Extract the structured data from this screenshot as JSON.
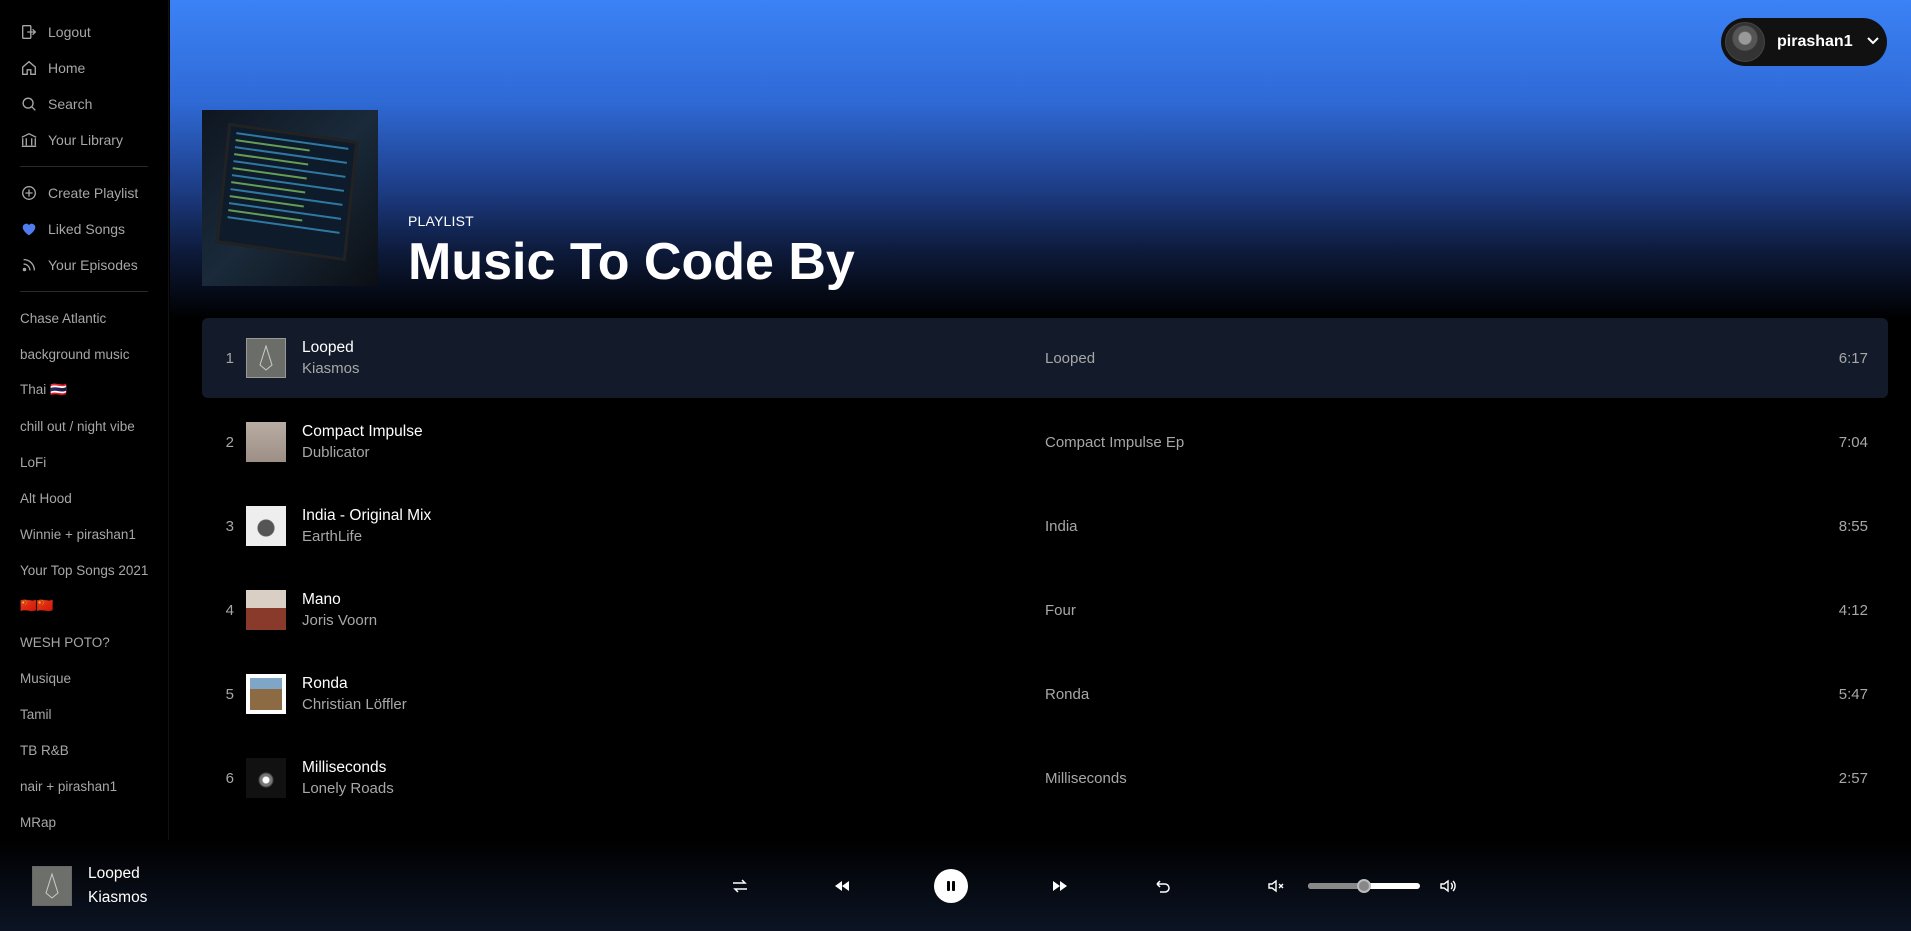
{
  "nav": {
    "logout": "Logout",
    "home": "Home",
    "search": "Search",
    "library": "Your Library",
    "create_playlist": "Create Playlist",
    "liked_songs": "Liked Songs",
    "episodes": "Your Episodes"
  },
  "playlists": [
    "Chase Atlantic",
    "background music",
    "Thai 🇹🇭",
    "chill out / night vibe",
    "LoFi",
    "Alt Hood",
    "Winnie + pirashan1",
    "Your Top Songs 2021",
    "🇨🇳🇨🇳",
    "WESH POTO?",
    "Musique",
    "Tamil",
    "TB R&B",
    "nair + pirashan1",
    "MRap"
  ],
  "user": {
    "name": "pirashan1"
  },
  "header": {
    "kind": "PLAYLIST",
    "title": "Music To Code By"
  },
  "tracks": [
    {
      "num": "1",
      "title": "Looped",
      "artist": "Kiasmos",
      "album": "Looped",
      "duration": "6:17"
    },
    {
      "num": "2",
      "title": "Compact Impulse",
      "artist": "Dublicator",
      "album": "Compact Impulse Ep",
      "duration": "7:04"
    },
    {
      "num": "3",
      "title": "India - Original Mix",
      "artist": "EarthLife",
      "album": "India",
      "duration": "8:55"
    },
    {
      "num": "4",
      "title": "Mano",
      "artist": "Joris Voorn",
      "album": "Four",
      "duration": "4:12"
    },
    {
      "num": "5",
      "title": "Ronda",
      "artist": "Christian Löffler",
      "album": "Ronda",
      "duration": "5:47"
    },
    {
      "num": "6",
      "title": "Milliseconds",
      "artist": "Lonely Roads",
      "album": "Milliseconds",
      "duration": "2:57"
    }
  ],
  "now_playing": {
    "title": "Looped",
    "artist": "Kiasmos"
  },
  "player": {
    "volume": 0.5
  },
  "colors": {
    "accent": "#3b82f6",
    "active_row": "#131b2a",
    "liked_heart": "#4f7df0"
  }
}
